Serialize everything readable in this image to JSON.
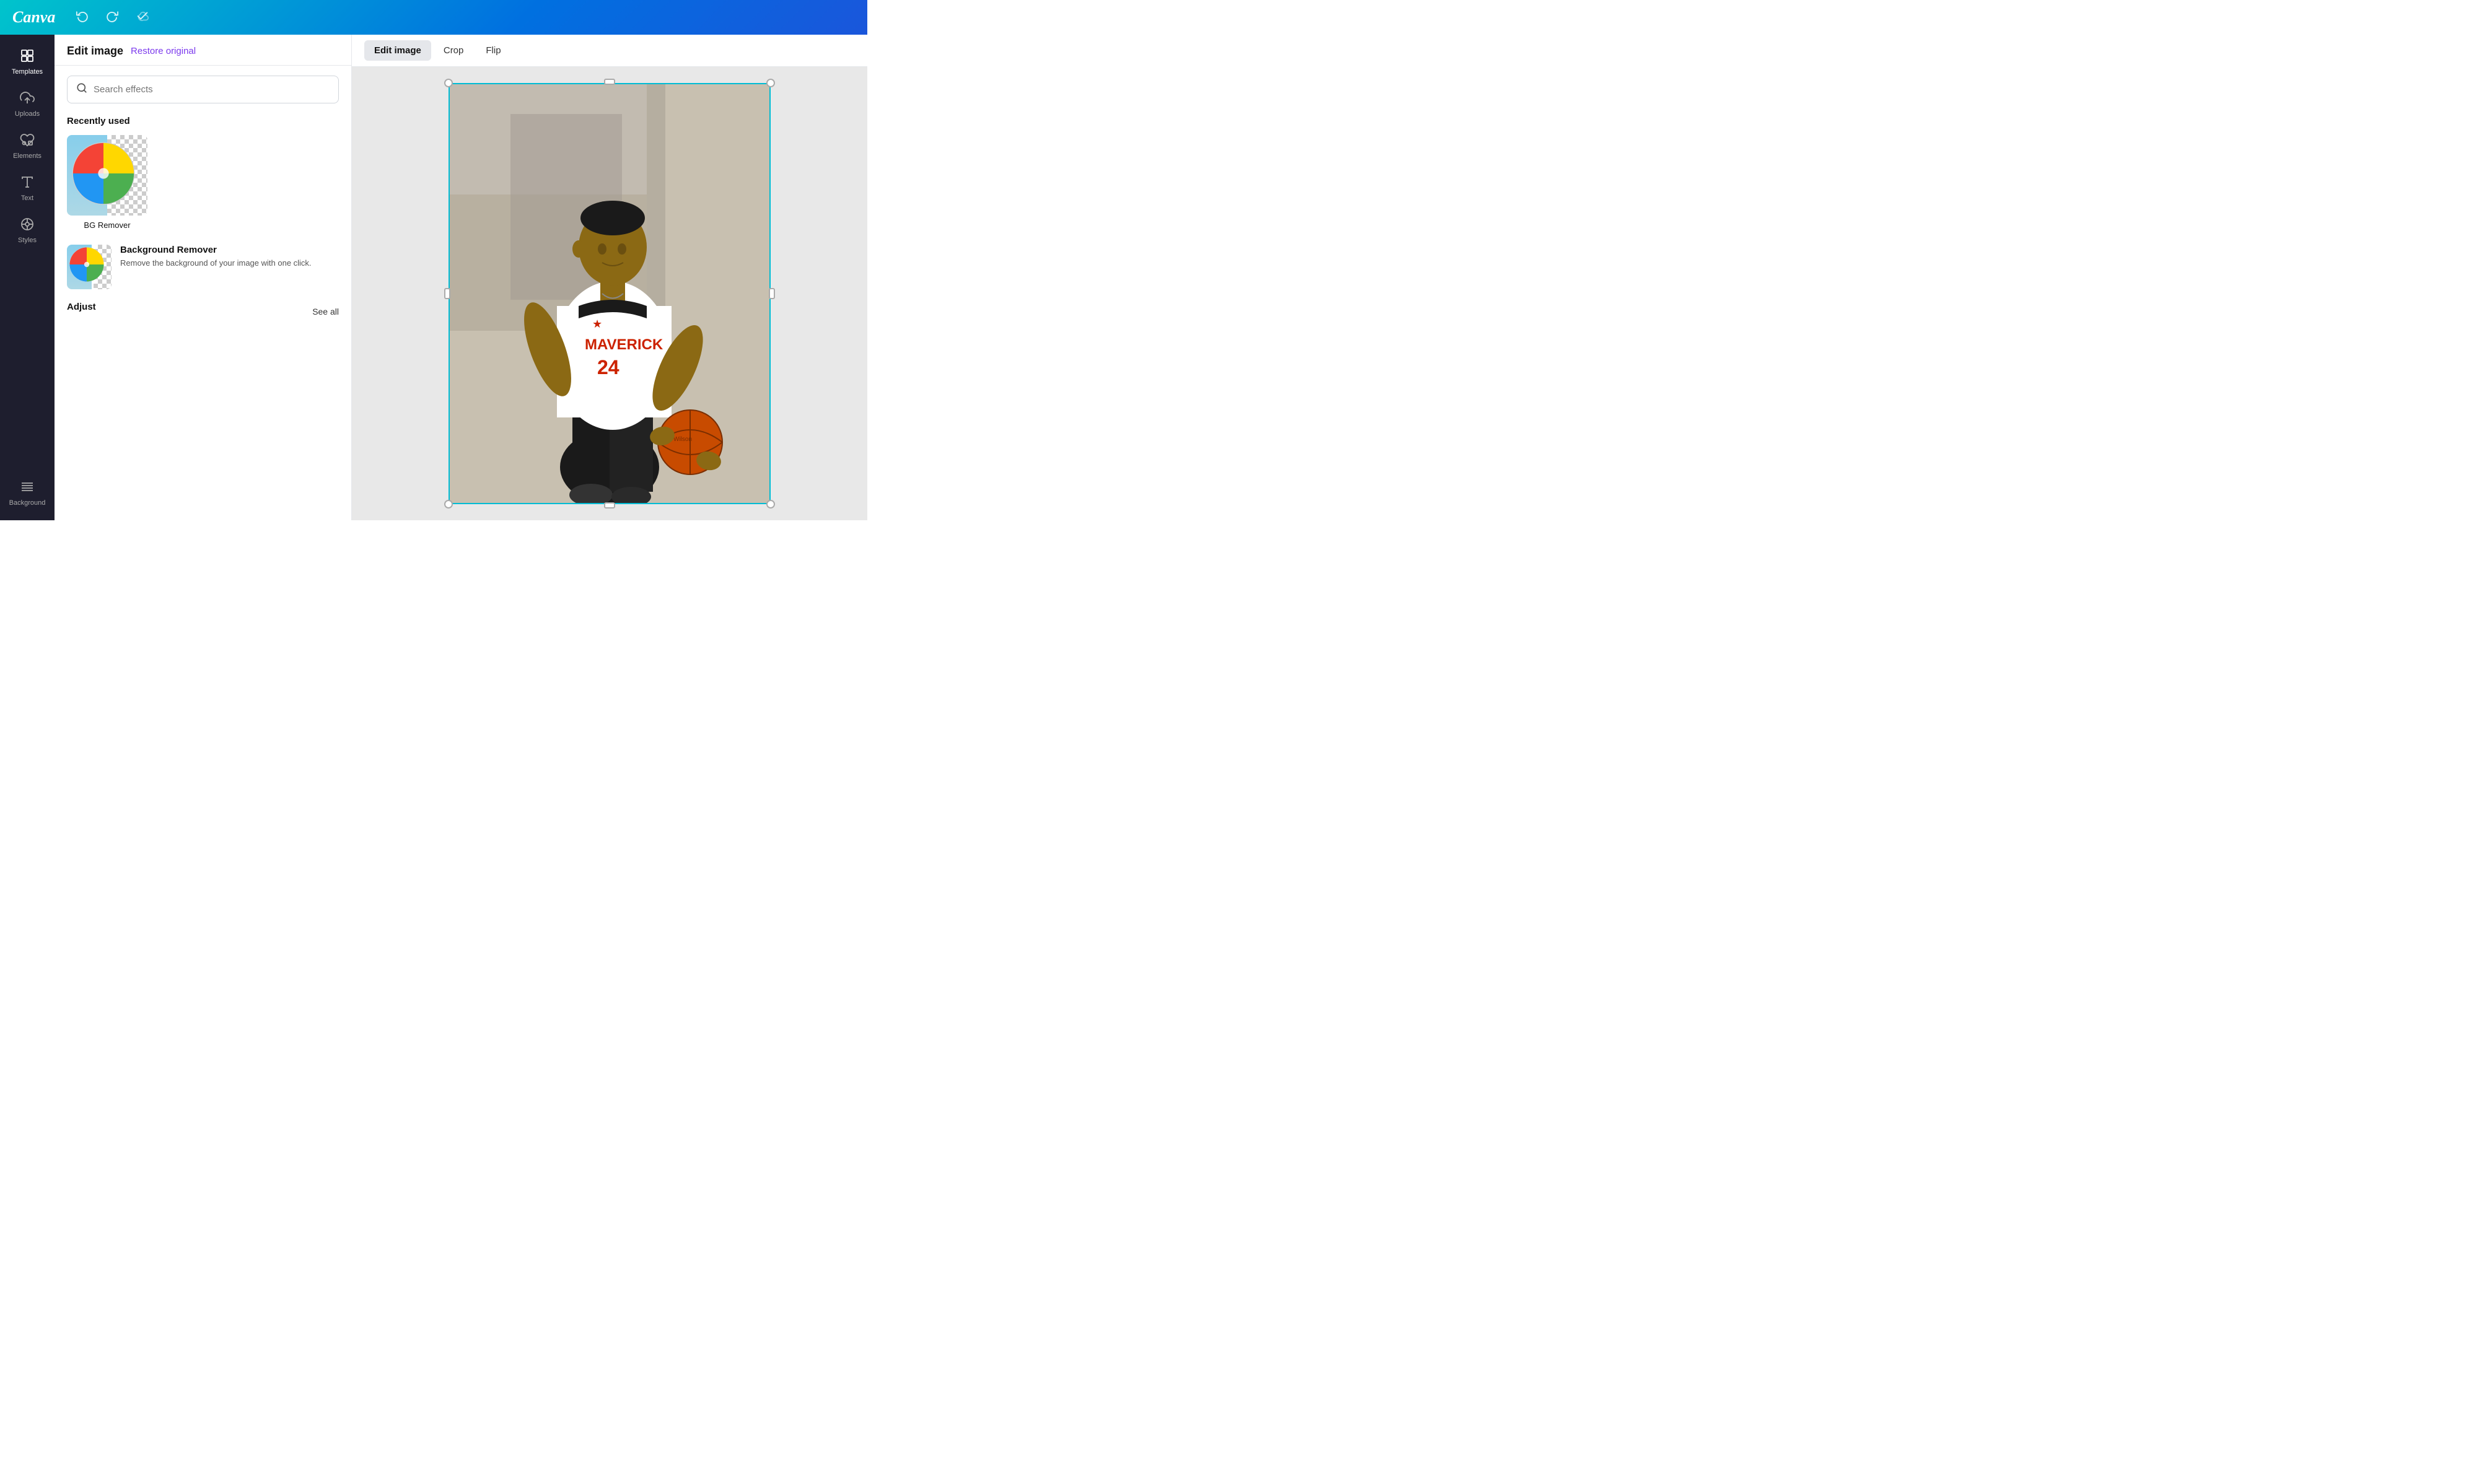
{
  "topbar": {
    "logo": "Canva",
    "undo_label": "↩",
    "redo_label": "↪",
    "cloud_label": "☁"
  },
  "sidebar": {
    "items": [
      {
        "id": "templates",
        "icon": "⊞",
        "label": "Templates",
        "active": true
      },
      {
        "id": "uploads",
        "icon": "⬆",
        "label": "Uploads",
        "active": false
      },
      {
        "id": "elements",
        "icon": "♡△□○",
        "label": "Elements",
        "active": false
      },
      {
        "id": "text",
        "icon": "T",
        "label": "Text",
        "active": false
      },
      {
        "id": "styles",
        "icon": "◉",
        "label": "Styles",
        "active": false
      },
      {
        "id": "background",
        "icon": "▤",
        "label": "Background",
        "active": false
      }
    ]
  },
  "panel": {
    "title": "Edit image",
    "restore_label": "Restore original",
    "search_placeholder": "Search effects",
    "recently_used_label": "Recently used",
    "bg_remover_label": "BG Remover",
    "effect_name": "Background Remover",
    "effect_desc": "Remove the background of your image with one click.",
    "adjust_label": "Adjust",
    "see_all_label": "See all"
  },
  "canvas_toolbar": {
    "tabs": [
      {
        "id": "edit-image",
        "label": "Edit image",
        "active": true
      },
      {
        "id": "crop",
        "label": "Crop",
        "active": false
      },
      {
        "id": "flip",
        "label": "Flip",
        "active": false
      }
    ]
  }
}
